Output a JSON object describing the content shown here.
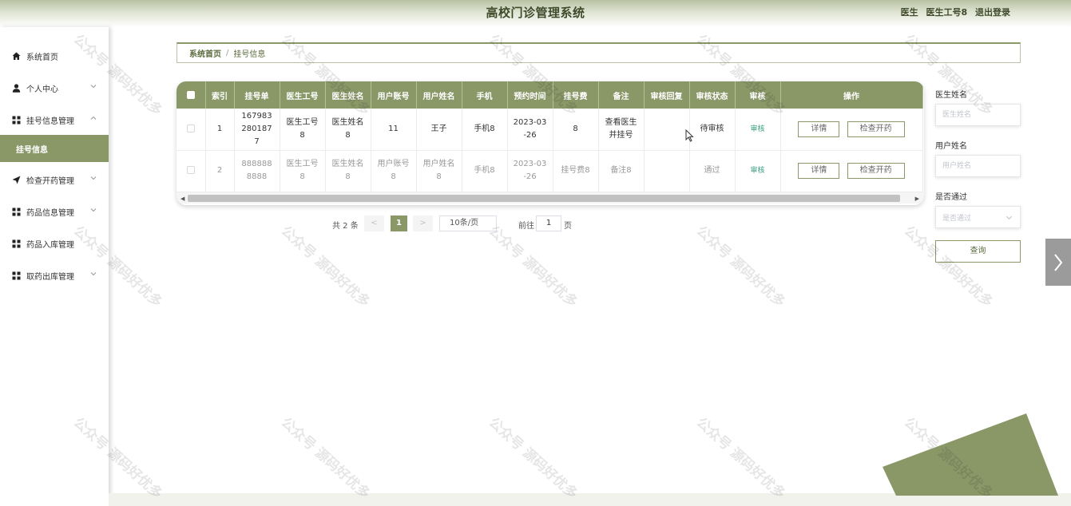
{
  "header": {
    "title": "高校门诊管理系统",
    "role": "医生",
    "user": "医生工号8",
    "logout": "退出登录"
  },
  "sidebar": {
    "items": [
      {
        "label": "系统首页",
        "icon": "home-icon"
      },
      {
        "label": "个人中心",
        "icon": "user-icon"
      },
      {
        "label": "挂号信息管理",
        "icon": "grid-icon"
      },
      {
        "label": "挂号信息",
        "icon": ""
      },
      {
        "label": "检查开药管理",
        "icon": "send-icon"
      },
      {
        "label": "药品信息管理",
        "icon": "grid-icon"
      },
      {
        "label": "药品入库管理",
        "icon": "grid-icon"
      },
      {
        "label": "取药出库管理",
        "icon": "grid-icon"
      }
    ]
  },
  "breadcrumb": {
    "home": "系统首页",
    "separator": "/",
    "current": "挂号信息"
  },
  "table": {
    "columns": [
      "索引",
      "挂号单",
      "医生工号",
      "医生姓名",
      "用户账号",
      "用户姓名",
      "手机",
      "预约时间",
      "挂号费",
      "备注",
      "审核回复",
      "审核状态",
      "审核",
      "操作"
    ],
    "rows": [
      {
        "index": "1",
        "order_no": "1679832801877",
        "doctor_id": "医生工号8",
        "doctor_name": "医生姓名8",
        "account": "11",
        "user_name": "王子",
        "phone": "手机8",
        "time": "2023-03-26",
        "fee": "8",
        "remark": "查看医生并挂号",
        "reply": "",
        "status": "待审核",
        "audit": "审核",
        "detail_btn": "详情",
        "check_btn": "检查开药"
      },
      {
        "index": "2",
        "order_no": "8888888888",
        "doctor_id": "医生工号8",
        "doctor_name": "医生姓名8",
        "account": "用户账号8",
        "user_name": "用户姓名8",
        "phone": "手机8",
        "time": "2023-03-26",
        "fee": "挂号费8",
        "remark": "备注8",
        "reply": "",
        "status": "通过",
        "audit": "审核",
        "detail_btn": "详情",
        "check_btn": "检查开药"
      }
    ]
  },
  "pagination": {
    "total": "共 2 条",
    "prev": "<",
    "current_page": "1",
    "next": ">",
    "page_size": "10条/页",
    "goto_label": "前往",
    "goto_value": "1",
    "unit": "页"
  },
  "search": {
    "doctor_name_label": "医生姓名",
    "doctor_name_placeholder": "医生姓名",
    "user_name_label": "用户姓名",
    "user_name_placeholder": "用户姓名",
    "pass_label": "是否通过",
    "pass_placeholder": "是否通过",
    "button": "查询"
  },
  "watermark": "公众号 源码好优多",
  "colors": {
    "accent": "#8a9868",
    "accent_dark": "#5a6a3c",
    "link": "#3aa080"
  }
}
